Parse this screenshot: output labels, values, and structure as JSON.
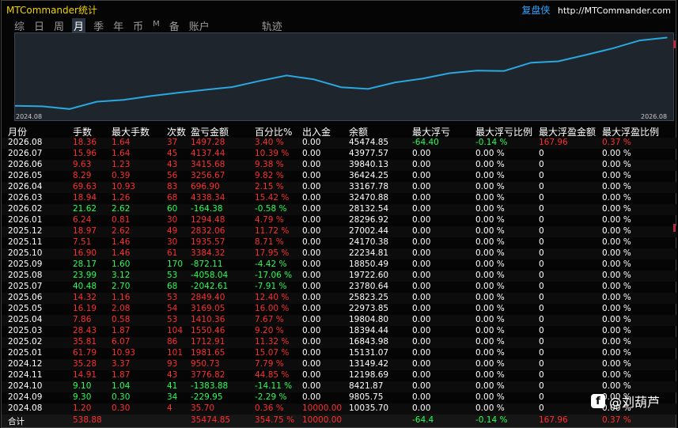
{
  "window": {
    "title": "MTCommander统计",
    "brand": "复盘侠",
    "url": "http://MTCommander.com"
  },
  "tabs": [
    {
      "label": "综",
      "active": false
    },
    {
      "label": "日",
      "active": false
    },
    {
      "label": "周",
      "active": false
    },
    {
      "label": "月",
      "active": true
    },
    {
      "label": "季",
      "active": false
    },
    {
      "label": "年",
      "active": false
    },
    {
      "label": "币",
      "active": false
    },
    {
      "label": "M",
      "active": false
    },
    {
      "label": "备",
      "active": false
    },
    {
      "label": "账户",
      "active": false
    },
    {
      "label": "轨迹",
      "active": false
    }
  ],
  "chart_data": {
    "type": "line",
    "x_start_label": "2024.08",
    "x_end_label": "2026.08",
    "x": [
      "2024.08",
      "2024.09",
      "2024.10",
      "2024.11",
      "2024.12",
      "2025.01",
      "2025.02",
      "2025.03",
      "2025.04",
      "2025.05",
      "2025.06",
      "2025.07",
      "2025.08",
      "2025.09",
      "2025.10",
      "2025.11",
      "2025.12",
      "2026.01",
      "2026.02",
      "2026.03",
      "2026.04",
      "2026.05",
      "2026.06",
      "2026.07",
      "2026.08"
    ],
    "series": [
      {
        "values": [
          10035.7,
          9805.75,
          8421.87,
          12198.69,
          13149.42,
          15131.07,
          16843.98,
          18394.44,
          19804.8,
          22973.85,
          25823.25,
          23780.64,
          19722.6,
          18850.49,
          22234.81,
          24170.38,
          27002.44,
          28296.92,
          28132.54,
          32470.88,
          33167.78,
          36424.25,
          39840.13,
          43977.57,
          45474.85
        ],
        "color": "#29a8e0"
      }
    ],
    "ylim": [
      7500,
      46500
    ],
    "grid": false,
    "legend": "none"
  },
  "columns": [
    "月份",
    "手数",
    "最大手数",
    "次数",
    "盈亏金额",
    "百分比%",
    "出入金",
    "余额",
    "最大浮亏",
    "最大浮亏比例",
    "最大浮盈金额",
    "最大浮盈比例"
  ],
  "rows": [
    {
      "month": "2026.08",
      "lots": "18.36",
      "max_lots": "1.64",
      "trades": "37",
      "pnl": "1497.28",
      "pct": "3.40 %",
      "flow": "0.00",
      "balance": "45474.85",
      "max_dd": "-64.40",
      "max_dd_pct": "-0.14 %",
      "max_fp": "167.96",
      "max_fp_pct": "0.37 %",
      "neg": false
    },
    {
      "month": "2026.07",
      "lots": "15.96",
      "max_lots": "1.64",
      "trades": "45",
      "pnl": "4137.44",
      "pct": "10.39 %",
      "flow": "0.00",
      "balance": "43977.57",
      "max_dd": "0.00",
      "max_dd_pct": "0.00 %",
      "max_fp": "0",
      "max_fp_pct": "0.00 %",
      "neg": false
    },
    {
      "month": "2026.06",
      "lots": "9.63",
      "max_lots": "1.23",
      "trades": "43",
      "pnl": "3415.68",
      "pct": "9.38 %",
      "flow": "0.00",
      "balance": "39840.13",
      "max_dd": "0.00",
      "max_dd_pct": "0.00 %",
      "max_fp": "0",
      "max_fp_pct": "0.00 %",
      "neg": false
    },
    {
      "month": "2026.05",
      "lots": "8.29",
      "max_lots": "0.39",
      "trades": "56",
      "pnl": "3256.67",
      "pct": "9.82 %",
      "flow": "0.00",
      "balance": "36424.25",
      "max_dd": "0.00",
      "max_dd_pct": "0.00 %",
      "max_fp": "0",
      "max_fp_pct": "0.00 %",
      "neg": false
    },
    {
      "month": "2026.04",
      "lots": "69.63",
      "max_lots": "10.93",
      "trades": "83",
      "pnl": "696.90",
      "pct": "2.15 %",
      "flow": "0.00",
      "balance": "33167.78",
      "max_dd": "0.00",
      "max_dd_pct": "0.00 %",
      "max_fp": "0",
      "max_fp_pct": "0.00 %",
      "neg": false
    },
    {
      "month": "2026.03",
      "lots": "18.94",
      "max_lots": "1.26",
      "trades": "68",
      "pnl": "4338.34",
      "pct": "15.42 %",
      "flow": "0.00",
      "balance": "32470.88",
      "max_dd": "0.00",
      "max_dd_pct": "0.00 %",
      "max_fp": "0",
      "max_fp_pct": "0.00 %",
      "neg": false
    },
    {
      "month": "2026.02",
      "lots": "21.62",
      "max_lots": "2.62",
      "trades": "60",
      "pnl": "-164.38",
      "pct": "-0.58 %",
      "flow": "0.00",
      "balance": "28132.54",
      "max_dd": "0.00",
      "max_dd_pct": "0.00 %",
      "max_fp": "0",
      "max_fp_pct": "0.00 %",
      "neg": true
    },
    {
      "month": "2026.01",
      "lots": "6.24",
      "max_lots": "0.81",
      "trades": "30",
      "pnl": "1294.48",
      "pct": "4.79 %",
      "flow": "0.00",
      "balance": "28296.92",
      "max_dd": "0.00",
      "max_dd_pct": "0.00 %",
      "max_fp": "0",
      "max_fp_pct": "0.00 %",
      "neg": false
    },
    {
      "month": "2025.12",
      "lots": "18.97",
      "max_lots": "2.62",
      "trades": "49",
      "pnl": "2832.06",
      "pct": "11.72 %",
      "flow": "0.00",
      "balance": "27002.44",
      "max_dd": "0.00",
      "max_dd_pct": "0.00 %",
      "max_fp": "0",
      "max_fp_pct": "0.00 %",
      "neg": false
    },
    {
      "month": "2025.11",
      "lots": "7.51",
      "max_lots": "1.46",
      "trades": "30",
      "pnl": "1935.57",
      "pct": "8.71 %",
      "flow": "0.00",
      "balance": "24170.38",
      "max_dd": "0.00",
      "max_dd_pct": "0.00 %",
      "max_fp": "0",
      "max_fp_pct": "0.00 %",
      "neg": false
    },
    {
      "month": "2025.10",
      "lots": "16.90",
      "max_lots": "1.46",
      "trades": "61",
      "pnl": "3384.32",
      "pct": "17.95 %",
      "flow": "0.00",
      "balance": "22234.81",
      "max_dd": "0.00",
      "max_dd_pct": "0.00 %",
      "max_fp": "0",
      "max_fp_pct": "0.00 %",
      "neg": false
    },
    {
      "month": "2025.09",
      "lots": "28.17",
      "max_lots": "1.60",
      "trades": "170",
      "pnl": "-872.11",
      "pct": "-4.42 %",
      "flow": "0.00",
      "balance": "18850.49",
      "max_dd": "0.00",
      "max_dd_pct": "0.00 %",
      "max_fp": "0",
      "max_fp_pct": "0.00 %",
      "neg": true
    },
    {
      "month": "2025.08",
      "lots": "23.99",
      "max_lots": "3.12",
      "trades": "53",
      "pnl": "-4058.04",
      "pct": "-17.06 %",
      "flow": "0.00",
      "balance": "19722.60",
      "max_dd": "0.00",
      "max_dd_pct": "0.00 %",
      "max_fp": "0",
      "max_fp_pct": "0.00 %",
      "neg": true
    },
    {
      "month": "2025.07",
      "lots": "40.48",
      "max_lots": "2.70",
      "trades": "68",
      "pnl": "-2042.61",
      "pct": "-7.91 %",
      "flow": "0.00",
      "balance": "23780.64",
      "max_dd": "0.00",
      "max_dd_pct": "0.00 %",
      "max_fp": "0",
      "max_fp_pct": "0.00 %",
      "neg": true
    },
    {
      "month": "2025.06",
      "lots": "14.32",
      "max_lots": "1.16",
      "trades": "53",
      "pnl": "2849.40",
      "pct": "12.40 %",
      "flow": "0.00",
      "balance": "25823.25",
      "max_dd": "0.00",
      "max_dd_pct": "0.00 %",
      "max_fp": "0",
      "max_fp_pct": "0.00 %",
      "neg": false
    },
    {
      "month": "2025.05",
      "lots": "16.19",
      "max_lots": "2.08",
      "trades": "54",
      "pnl": "3169.05",
      "pct": "16.00 %",
      "flow": "0.00",
      "balance": "22973.85",
      "max_dd": "0.00",
      "max_dd_pct": "0.00 %",
      "max_fp": "0",
      "max_fp_pct": "0.00 %",
      "neg": false
    },
    {
      "month": "2025.04",
      "lots": "7.86",
      "max_lots": "0.58",
      "trades": "53",
      "pnl": "1410.36",
      "pct": "7.67 %",
      "flow": "0.00",
      "balance": "19804.80",
      "max_dd": "0.00",
      "max_dd_pct": "0.00 %",
      "max_fp": "0",
      "max_fp_pct": "0.00 %",
      "neg": false
    },
    {
      "month": "2025.03",
      "lots": "28.43",
      "max_lots": "1.87",
      "trades": "104",
      "pnl": "1550.46",
      "pct": "9.20 %",
      "flow": "0.00",
      "balance": "18394.44",
      "max_dd": "0.00",
      "max_dd_pct": "0.00 %",
      "max_fp": "0",
      "max_fp_pct": "0.00 %",
      "neg": false
    },
    {
      "month": "2025.02",
      "lots": "35.81",
      "max_lots": "6.07",
      "trades": "86",
      "pnl": "1712.91",
      "pct": "11.32 %",
      "flow": "0.00",
      "balance": "16843.98",
      "max_dd": "0.00",
      "max_dd_pct": "0.00 %",
      "max_fp": "0",
      "max_fp_pct": "0.00 %",
      "neg": false
    },
    {
      "month": "2025.01",
      "lots": "61.79",
      "max_lots": "10.93",
      "trades": "101",
      "pnl": "1981.65",
      "pct": "15.07 %",
      "flow": "0.00",
      "balance": "15131.07",
      "max_dd": "0.00",
      "max_dd_pct": "0.00 %",
      "max_fp": "0",
      "max_fp_pct": "0.00 %",
      "neg": false
    },
    {
      "month": "2024.12",
      "lots": "35.28",
      "max_lots": "3.37",
      "trades": "93",
      "pnl": "950.73",
      "pct": "7.79 %",
      "flow": "0.00",
      "balance": "13149.42",
      "max_dd": "0.00",
      "max_dd_pct": "0.00 %",
      "max_fp": "0",
      "max_fp_pct": "0.00 %",
      "neg": false
    },
    {
      "month": "2024.11",
      "lots": "14.91",
      "max_lots": "1.87",
      "trades": "43",
      "pnl": "3776.82",
      "pct": "44.85 %",
      "flow": "0.00",
      "balance": "12198.69",
      "max_dd": "0.00",
      "max_dd_pct": "0.00 %",
      "max_fp": "0",
      "max_fp_pct": "0.00 %",
      "neg": false
    },
    {
      "month": "2024.10",
      "lots": "9.10",
      "max_lots": "1.04",
      "trades": "41",
      "pnl": "-1383.88",
      "pct": "-14.11 %",
      "flow": "0.00",
      "balance": "8421.87",
      "max_dd": "0.00",
      "max_dd_pct": "0.00 %",
      "max_fp": "0",
      "max_fp_pct": "0.00 %",
      "neg": true
    },
    {
      "month": "2024.09",
      "lots": "9.30",
      "max_lots": "0.30",
      "trades": "34",
      "pnl": "-229.95",
      "pct": "-2.29 %",
      "flow": "0.00",
      "balance": "9805.75",
      "max_dd": "0.00",
      "max_dd_pct": "0.00 %",
      "max_fp": "0",
      "max_fp_pct": "0.00 %",
      "neg": true
    },
    {
      "month": "2024.08",
      "lots": "1.20",
      "max_lots": "0.30",
      "trades": "4",
      "pnl": "35.70",
      "pct": "0.36 %",
      "flow": "10000.00",
      "balance": "10035.70",
      "max_dd": "0.00",
      "max_dd_pct": "0.00 %",
      "max_fp": "0",
      "max_fp_pct": "0.00 %",
      "neg": false
    }
  ],
  "total": {
    "label": "合计",
    "lots": "538.88",
    "pnl": "35474.85",
    "pct": "354.75 %",
    "flow": "10000.00",
    "max_dd": "-64.4",
    "max_dd_pct": "-0.14 %",
    "max_fp": "167.96",
    "max_fp_pct": "0.37 %"
  },
  "watermark": {
    "icon": "f",
    "text": "@刘葫芦"
  },
  "colors": {
    "positive": "#ff2d2d",
    "negative": "#22ff55",
    "line": "#29a8e0",
    "title": "#f2d300",
    "brand": "#2fa6ff"
  }
}
